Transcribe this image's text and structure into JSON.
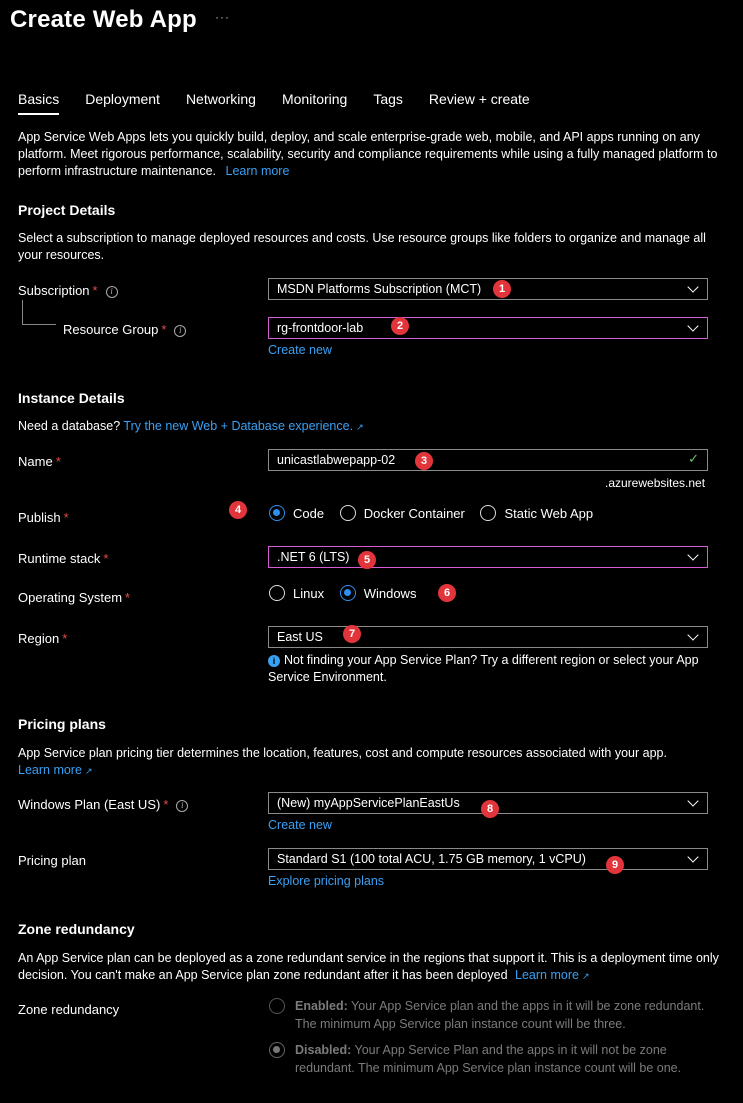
{
  "header": {
    "title": "Create Web App",
    "more": "···"
  },
  "tabs": [
    "Basics",
    "Deployment",
    "Networking",
    "Monitoring",
    "Tags",
    "Review + create"
  ],
  "intro": {
    "text": "App Service Web Apps lets you quickly build, deploy, and scale enterprise-grade web, mobile, and API apps running on any platform. Meet rigorous performance, scalability, security and compliance requirements while using a fully managed platform to perform infrastructure maintenance.",
    "link": "Learn more"
  },
  "project": {
    "heading": "Project Details",
    "desc": "Select a subscription to manage deployed resources and costs. Use resource groups like folders to organize and manage all your resources.",
    "subscription_label": "Subscription",
    "subscription_value": "MSDN Platforms Subscription (MCT)",
    "rg_label": "Resource Group",
    "rg_value": "rg-frontdoor-lab",
    "create_new": "Create new"
  },
  "instance": {
    "heading": "Instance Details",
    "db_prompt": "Need a database?",
    "db_link": "Try the new Web + Database experience.",
    "name_label": "Name",
    "name_value": "unicastlabwepapp-02",
    "name_suffix": ".azurewebsites.net",
    "publish_label": "Publish",
    "publish_options": [
      "Code",
      "Docker Container",
      "Static Web App"
    ],
    "runtime_label": "Runtime stack",
    "runtime_value": ".NET 6 (LTS)",
    "os_label": "Operating System",
    "os_options": [
      "Linux",
      "Windows"
    ],
    "region_label": "Region",
    "region_value": "East US",
    "region_note": "Not finding your App Service Plan? Try a different region or select your App Service Environment."
  },
  "pricing": {
    "heading": "Pricing plans",
    "desc": "App Service plan pricing tier determines the location, features, cost and compute resources associated with your app.",
    "learn_more": "Learn more",
    "plan_label": "Windows Plan (East US)",
    "plan_value": "(New) myAppServicePlanEastUs",
    "create_new": "Create new",
    "pricing_label": "Pricing plan",
    "pricing_value": "Standard S1 (100 total ACU, 1.75 GB memory, 1 vCPU)",
    "explore": "Explore pricing plans"
  },
  "zone": {
    "heading": "Zone redundancy",
    "desc": "An App Service plan can be deployed as a zone redundant service in the regions that support it. This is a deployment time only decision. You can't make an App Service plan zone redundant after it has been deployed",
    "learn_more": "Learn more",
    "label": "Zone redundancy",
    "enabled_title": "Enabled:",
    "enabled_text": "Your App Service plan and the apps in it will be zone redundant. The minimum App Service plan instance count will be three.",
    "disabled_title": "Disabled:",
    "disabled_text": "Your App Service Plan and the apps in it will not be zone redundant. The minimum App Service plan instance count will be one."
  },
  "badges": [
    "1",
    "2",
    "3",
    "4",
    "5",
    "6",
    "7",
    "8",
    "9"
  ],
  "colors": {
    "accent": "#3aa0f3",
    "required": "#e84a4a",
    "badge": "#e2353b",
    "highlight_border": "#d65bd6"
  }
}
